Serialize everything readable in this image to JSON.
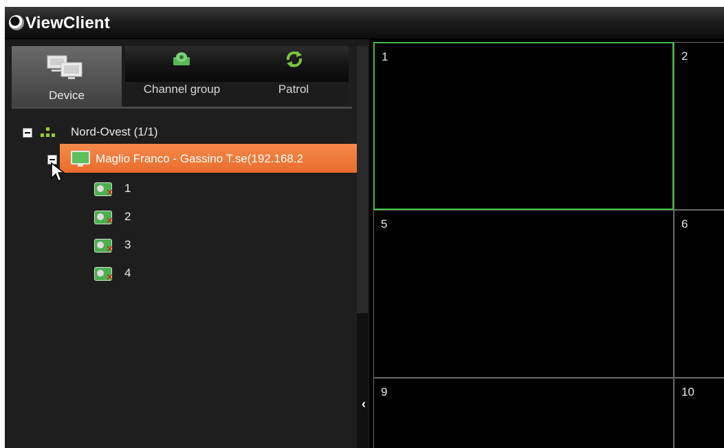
{
  "app": {
    "title": "ViewClient",
    "logo_icon": "viewclient-logo-icon"
  },
  "sidebar": {
    "tabs": [
      {
        "label": "Device",
        "icon": "device-monitors-icon",
        "active": true
      },
      {
        "label": "Channel group",
        "icon": "channel-group-icon",
        "active": false
      },
      {
        "label": "Patrol",
        "icon": "patrol-icon",
        "active": false
      }
    ],
    "collapse_glyph": "‹",
    "tree": {
      "group": {
        "label": "Nord-Ovest (1/1)",
        "icon": "network-group-icon"
      },
      "device": {
        "label": "Maglio Franco - Gassino T.se(192.168.2",
        "icon": "device-monitor-icon"
      },
      "channels": [
        {
          "label": "1",
          "icon": "camera-offline-icon"
        },
        {
          "label": "2",
          "icon": "camera-offline-icon"
        },
        {
          "label": "3",
          "icon": "camera-offline-icon"
        },
        {
          "label": "4",
          "icon": "camera-offline-icon"
        }
      ]
    }
  },
  "video_grid": {
    "active_border_color": "#40c040",
    "cells": [
      {
        "number": "1",
        "active": true
      },
      {
        "number": "2",
        "active": false
      },
      {
        "number": "5",
        "active": false
      },
      {
        "number": "6",
        "active": false
      },
      {
        "number": "9",
        "active": false
      },
      {
        "number": "10",
        "active": false
      }
    ]
  },
  "colors": {
    "selected_row": "#f07a3a",
    "background": "#1b1b1b"
  }
}
